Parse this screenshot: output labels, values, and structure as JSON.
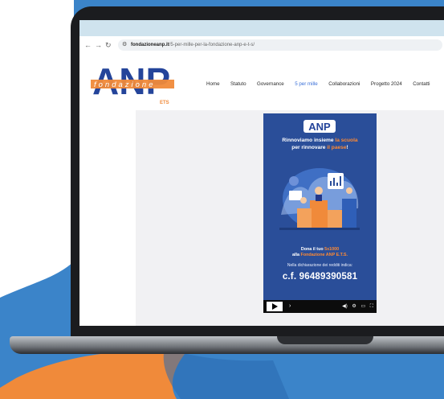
{
  "colors": {
    "background_blue": "#3b84c9",
    "accent_orange": "#f08a3a",
    "poster_blue": "#2a4e99",
    "nav_active": "#3a6fd8"
  },
  "browser": {
    "url_host": "fondazioneanp.it",
    "url_path": "/5-per-mille-per-la-fondazione-anp-e-t-s/",
    "icons": [
      "back-arrow-icon",
      "forward-arrow-icon",
      "reload-icon",
      "site-settings-icon"
    ]
  },
  "site": {
    "logo": {
      "letters": "ANP",
      "word": "fondazione",
      "suffix": "ETS"
    },
    "nav": [
      "Home",
      "Statuto",
      "Governance",
      "5 per mille",
      "Collaborazioni",
      "Progetto 2024",
      "Contatti"
    ],
    "active_nav": "5 per mille"
  },
  "video": {
    "logo_text": "ANP",
    "headline_1a": "Rinnoviamo insieme",
    "headline_1b": "la scuola",
    "headline_2a": "per rinnovare",
    "headline_2b": "il paese",
    "headline_2c": "!",
    "donate_1a": "Dona il tuo",
    "donate_1b": "5x1000",
    "donate_2a": "alla",
    "donate_2b": "Fondazione ANP E.T.S.",
    "note": "Nella dichiarazione dei redditi indica:",
    "fiscal_code": "c.f. 96489390581",
    "controls": {
      "play_icon": "play-icon",
      "skip_icon": "next-icon",
      "volume_icon": "volume-icon",
      "settings_icon": "gear-icon",
      "miniplayer_icon": "miniplayer-icon",
      "fullscreen_icon": "fullscreen-icon"
    }
  }
}
